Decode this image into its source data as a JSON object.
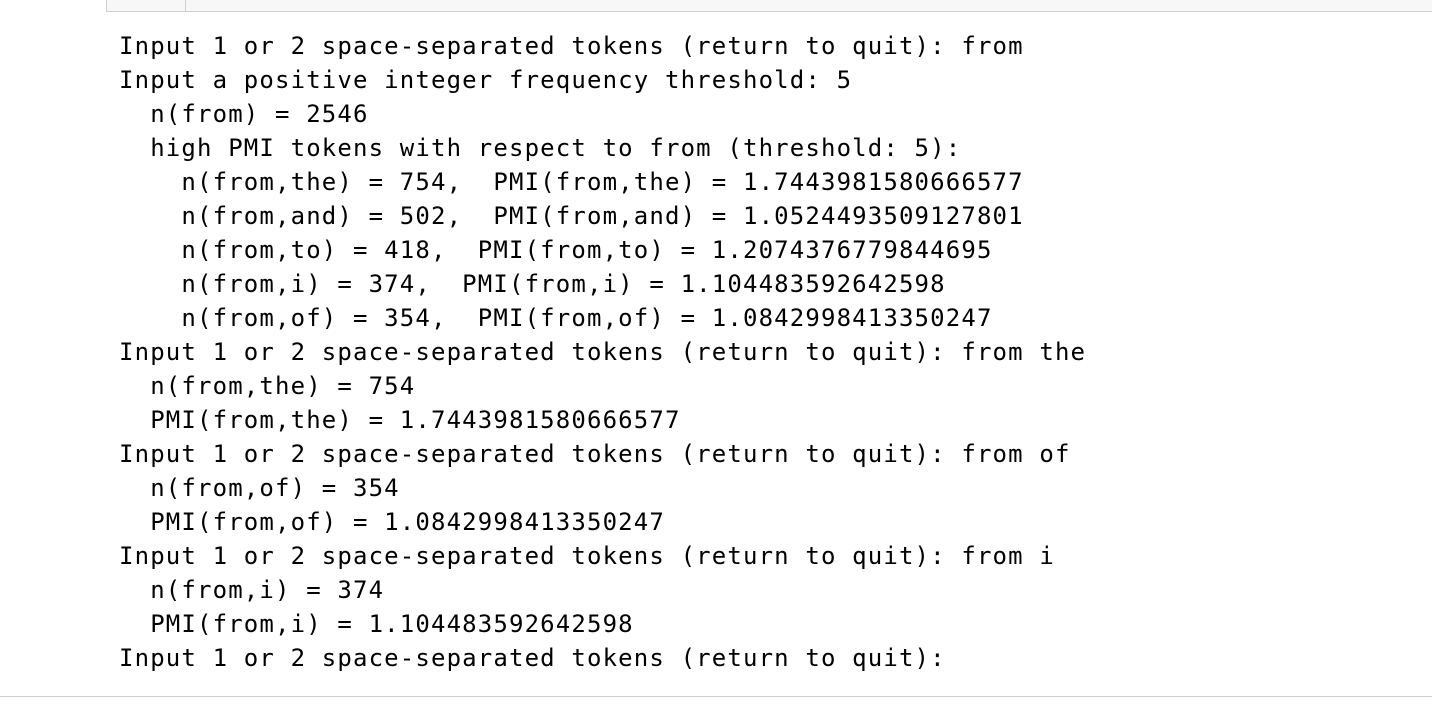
{
  "output": {
    "lines": [
      "Input 1 or 2 space-separated tokens (return to quit): from",
      "Input a positive integer frequency threshold: 5",
      "  n(from) = 2546",
      "  high PMI tokens with respect to from (threshold: 5):",
      "    n(from,the) = 754,  PMI(from,the) = 1.7443981580666577",
      "    n(from,and) = 502,  PMI(from,and) = 1.0524493509127801",
      "    n(from,to) = 418,  PMI(from,to) = 1.2074376779844695",
      "    n(from,i) = 374,  PMI(from,i) = 1.104483592642598",
      "    n(from,of) = 354,  PMI(from,of) = 1.0842998413350247",
      "Input 1 or 2 space-separated tokens (return to quit): from the",
      "  n(from,the) = 754",
      "  PMI(from,the) = 1.7443981580666577",
      "Input 1 or 2 space-separated tokens (return to quit): from of",
      "  n(from,of) = 354",
      "  PMI(from,of) = 1.0842998413350247",
      "Input 1 or 2 space-separated tokens (return to quit): from i",
      "  n(from,i) = 374",
      "  PMI(from,i) = 1.104483592642598",
      "Input 1 or 2 space-separated tokens (return to quit):"
    ]
  }
}
